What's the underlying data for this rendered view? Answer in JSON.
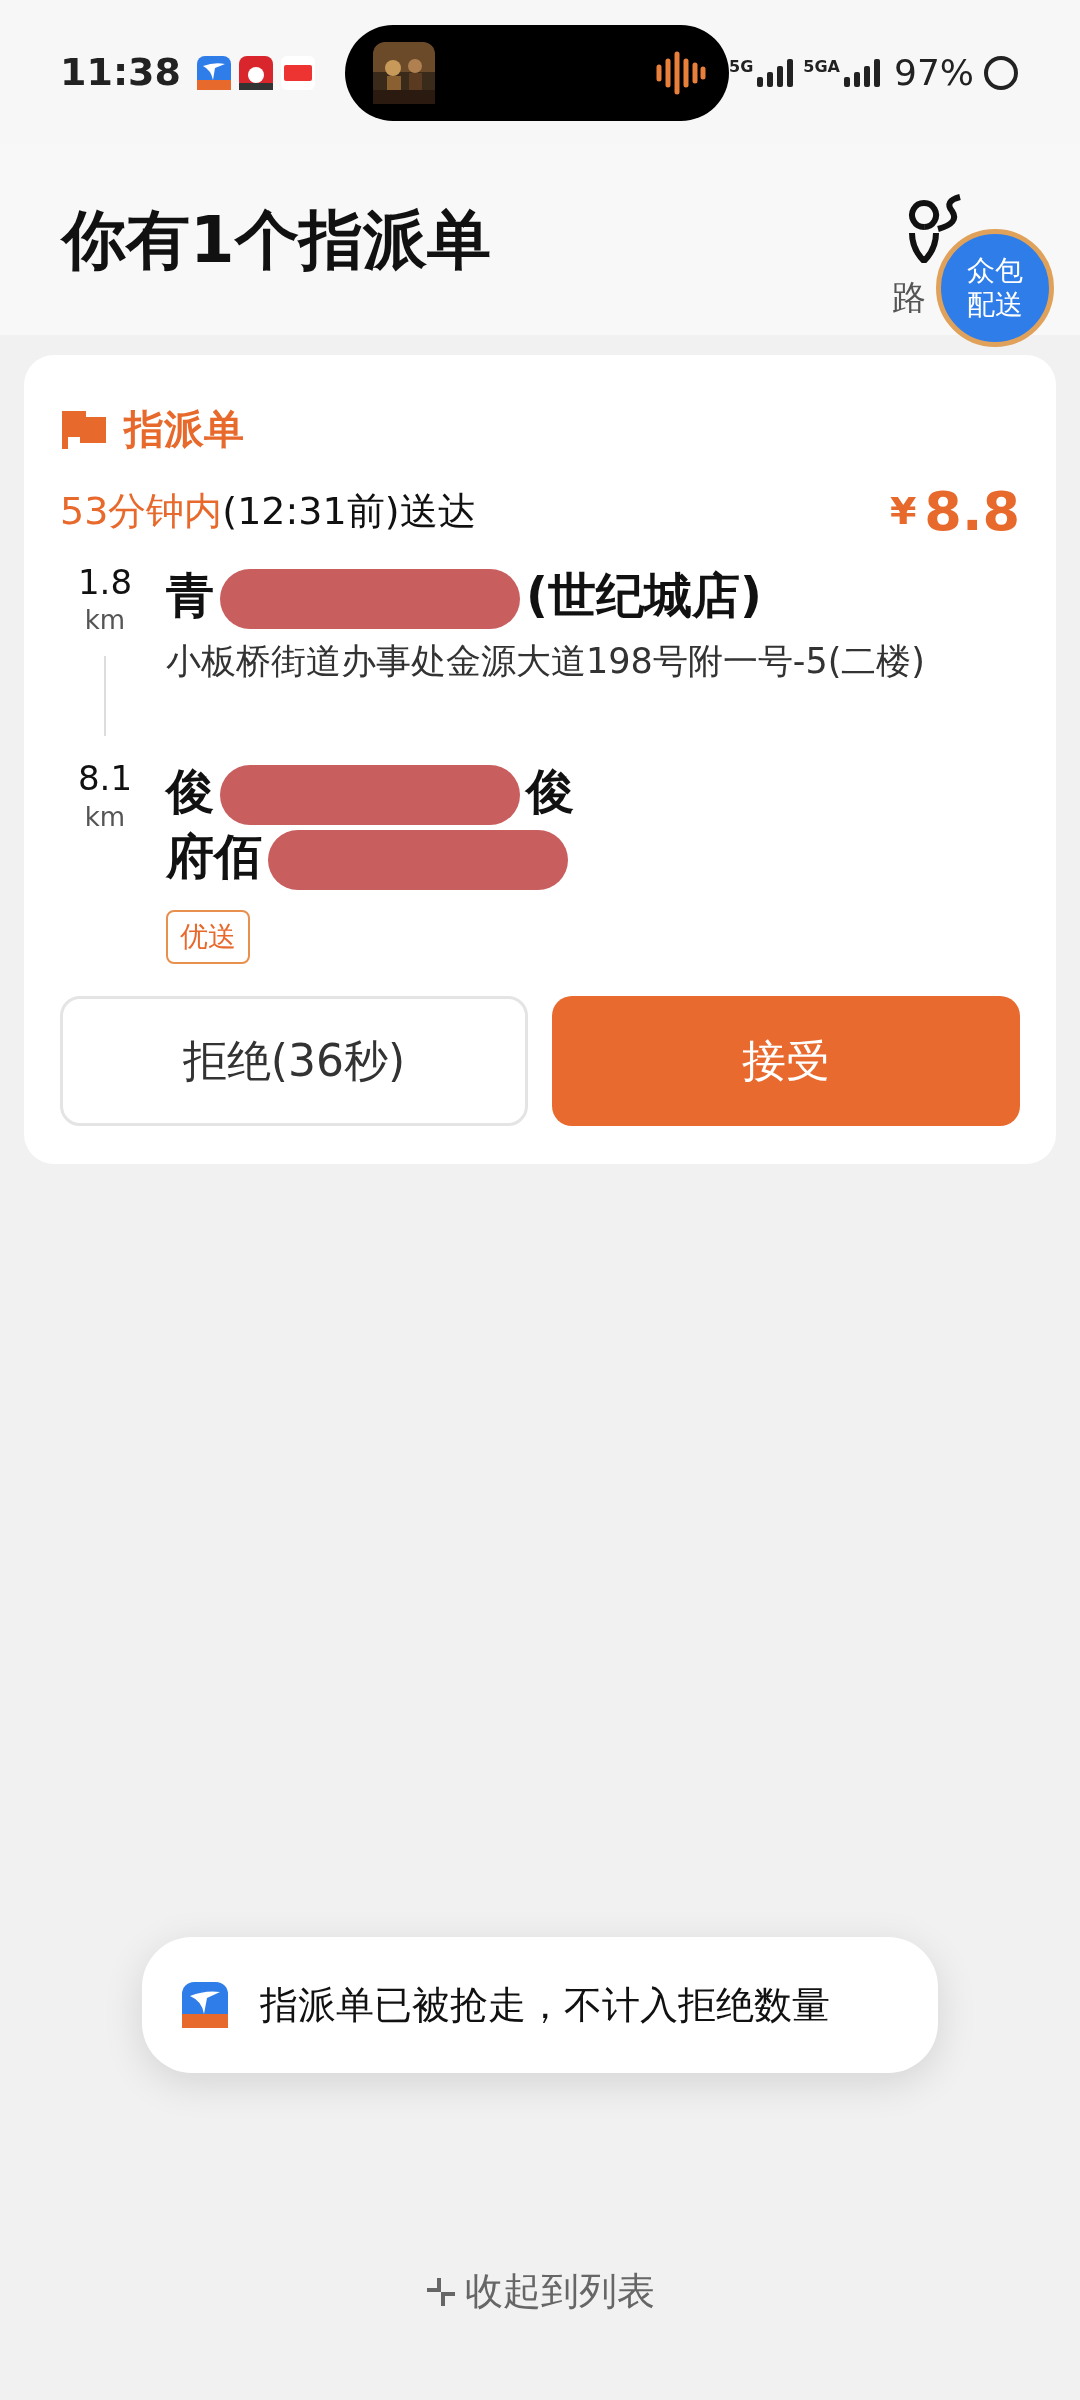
{
  "status_bar": {
    "time": "11:38",
    "network_1": "5G",
    "network_2": "5GA",
    "battery": "97%"
  },
  "header": {
    "title": "你有1个指派单",
    "route_label": "路",
    "crowd_badge": "众包配送"
  },
  "order": {
    "type_label": "指派单",
    "deadline_highlight": "53分钟内",
    "deadline_rest": "(12:31前)送达",
    "currency": "¥",
    "price": "8.8",
    "stops": [
      {
        "distance": "1.8",
        "unit": "km",
        "title": [
          {
            "kind": "text",
            "text": "青"
          },
          {
            "kind": "redacted"
          },
          {
            "kind": "text",
            "text": "(世纪城店)"
          }
        ],
        "address": "小板桥街道办事处金源大道198号附一号-5(二楼)"
      },
      {
        "distance": "8.1",
        "unit": "km",
        "title": [
          {
            "kind": "text",
            "text": "俊"
          },
          {
            "kind": "redacted"
          },
          {
            "kind": "text",
            "text": "俊"
          },
          {
            "kind": "break"
          },
          {
            "kind": "text",
            "text": "府佰"
          },
          {
            "kind": "redacted"
          }
        ],
        "tag": "优送"
      }
    ],
    "reject_button": "拒绝(36秒)",
    "accept_button": "接受"
  },
  "toast": {
    "message": "指派单已被抢走，不计入拒绝数量"
  },
  "collapse_link": "收起到列表"
}
